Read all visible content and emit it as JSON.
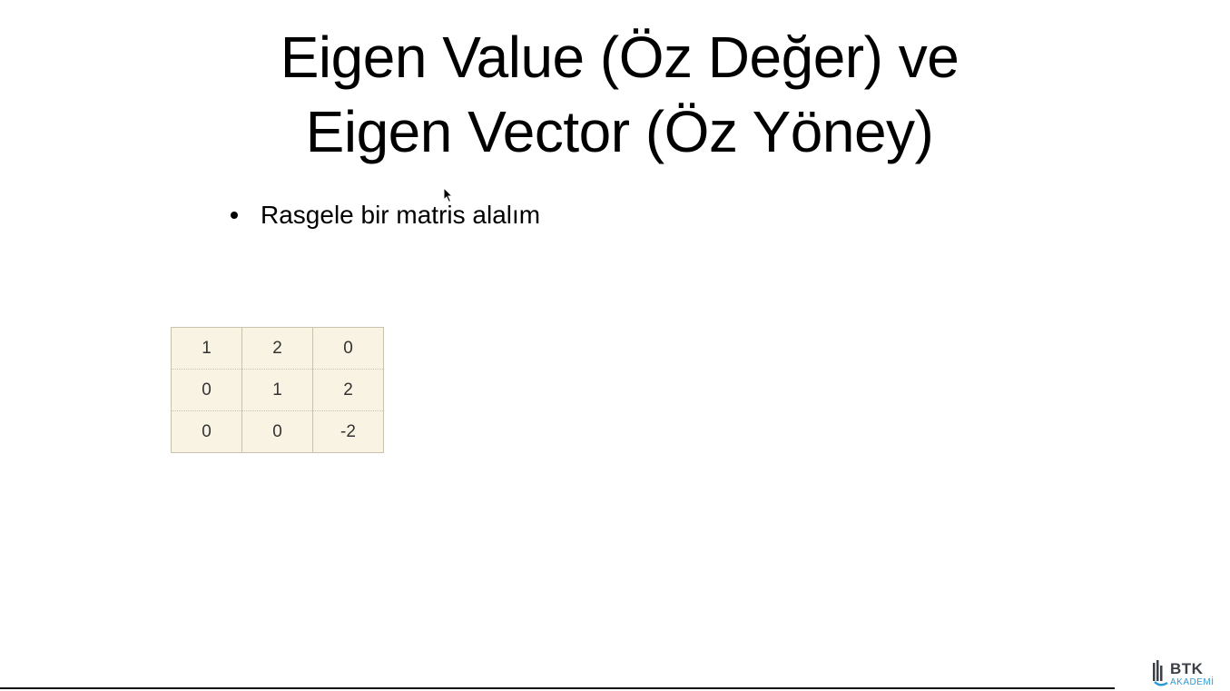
{
  "slide": {
    "title_line1": "Eigen Value (Öz Değer) ve",
    "title_line2": "Eigen Vector (Öz Yöney)",
    "bullets": [
      "Rasgele bir matris alalım"
    ],
    "matrix": [
      [
        "1",
        "2",
        "0"
      ],
      [
        "0",
        "1",
        "2"
      ],
      [
        "0",
        "0",
        "-2"
      ]
    ]
  },
  "logo": {
    "name": "BTK",
    "subtitle": "AKADEMİ"
  },
  "colors": {
    "matrix_background": "#f8f3e3",
    "matrix_border": "#c9c2ad",
    "logo_dark": "#3b3f46",
    "logo_accent": "#2e9bd6"
  }
}
